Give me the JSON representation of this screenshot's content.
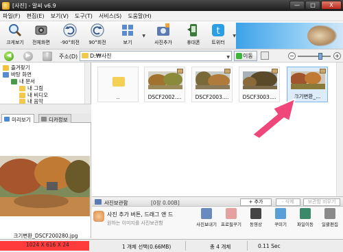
{
  "window": {
    "title": "[사진] - 알씨 v6.9",
    "minimize": "—",
    "maximize": "□",
    "close": "X"
  },
  "menu": [
    "파일(F)",
    "편집(E)",
    "보기(V)",
    "도구(T)",
    "서비스(S)",
    "도움말(H)"
  ],
  "toolbar": [
    {
      "label": "크게보기",
      "icon": "magnifier-icon"
    },
    {
      "label": "전체화면",
      "icon": "fullscreen-icon"
    },
    {
      "label": "-90°회전",
      "icon": "rotate-left-icon"
    },
    {
      "label": "90°회전",
      "icon": "rotate-right-icon"
    },
    {
      "label": "보기",
      "icon": "view-grid-icon"
    },
    {
      "label": "사진추가",
      "icon": "add-photo-icon"
    },
    {
      "label": "휴대폰",
      "icon": "phone-icon"
    },
    {
      "label": "트위터",
      "icon": "twitter-icon"
    }
  ],
  "address": {
    "label": "주소(D)",
    "path": "D:₩사진",
    "go": "이동"
  },
  "tree": [
    {
      "label": "즐겨찾기",
      "icon": "star-icon"
    },
    {
      "label": "바탕 화면",
      "icon": "desktop-icon"
    },
    {
      "label": "내 문서",
      "icon": "documents-icon"
    },
    {
      "label": "내 그림",
      "icon": "pictures-icon"
    },
    {
      "label": "내 비디오",
      "icon": "videos-icon"
    },
    {
      "label": "내 음악",
      "icon": "music-icon"
    }
  ],
  "preview_tabs": [
    "미리보기",
    "디카정보"
  ],
  "preview": {
    "filename": "크기변환_DSCF200280.jpg"
  },
  "thumbnails": [
    {
      "caption": "..",
      "type": "folder"
    },
    {
      "caption": "DSCF2002....",
      "type": "image"
    },
    {
      "caption": "DSCF2003....",
      "type": "image"
    },
    {
      "caption": "DSCF3003....",
      "type": "image"
    },
    {
      "caption": "크기변환_...",
      "type": "image",
      "selected": true
    }
  ],
  "storage": {
    "title": "사진보관함",
    "count": "[0장 0.00B]",
    "add_button": "+ 추가",
    "delete_button": "- 삭제",
    "save_button": "보관함 비우기",
    "message1": "사진 추가 버튼, 드래그 앤 드",
    "message2": "원하는 이미지를 사진보관함",
    "actions": [
      {
        "label": "사진보내기",
        "icon": "send-photo-icon"
      },
      {
        "label": "프로필꾸기",
        "icon": "profile-icon"
      },
      {
        "label": "동영상",
        "icon": "video-icon"
      },
      {
        "label": "꾸미기",
        "icon": "decorate-icon"
      },
      {
        "label": "파일이동",
        "icon": "move-file-icon"
      },
      {
        "label": "일괄편집",
        "icon": "batch-edit-icon"
      }
    ]
  },
  "status": {
    "dimensions": "1024 X 616 X 24",
    "selection": "1 개체 선택(0.66MB)",
    "total": "총 4 개체",
    "time": "0.11 Sec"
  }
}
